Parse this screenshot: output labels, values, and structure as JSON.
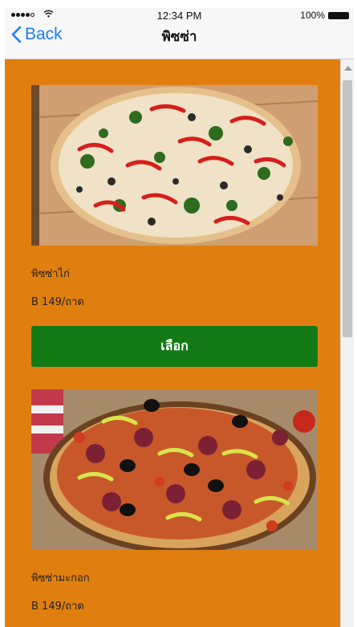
{
  "status_bar": {
    "time": "12:34 PM",
    "battery_percent": "100%",
    "signal_bars": 5,
    "signal_filled": 4
  },
  "nav": {
    "back_label": "Back",
    "title": "พิซซ่า"
  },
  "colors": {
    "background": "#e07f10",
    "select_button": "#147a16",
    "back_link": "#1a7cf5"
  },
  "items": [
    {
      "name": "พิซซ่าไก่",
      "price": "B 149/ถาด",
      "button_label": "เลือก",
      "image": "pizza-peppers-broccoli-olives"
    },
    {
      "name": "พิซซ่ามะกอก",
      "price": "B 149/ถาด"
    }
  ]
}
